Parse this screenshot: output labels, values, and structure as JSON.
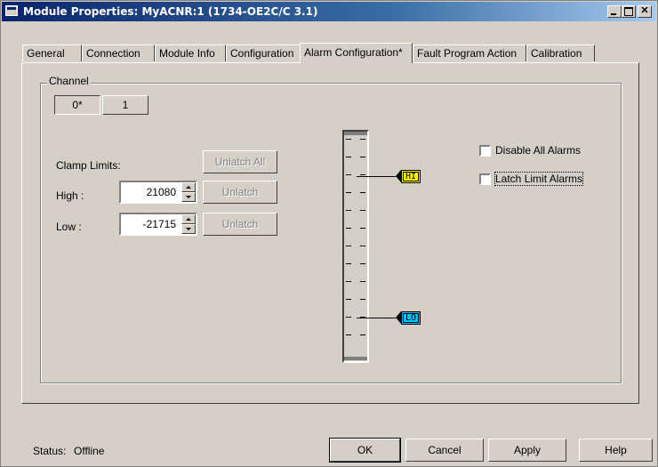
{
  "window": {
    "title": "Module Properties: MyACNR:1 (1734-OE2C/C 3.1)"
  },
  "tabs": [
    {
      "label": "General"
    },
    {
      "label": "Connection"
    },
    {
      "label": "Module Info"
    },
    {
      "label": "Configuration"
    },
    {
      "label": "Alarm Configuration*"
    },
    {
      "label": "Fault Program Action"
    },
    {
      "label": "Calibration"
    }
  ],
  "active_tab": "Alarm Configuration*",
  "channel": {
    "group_label": "Channel",
    "buttons": [
      {
        "label": "0*",
        "selected": true
      },
      {
        "label": "1",
        "selected": false
      }
    ]
  },
  "clamp": {
    "label": "Clamp Limits:",
    "unlatch_all_label": "Unlatch All",
    "high_label": "High :",
    "high_value": "21080",
    "low_label": "Low :",
    "low_value": "-21715",
    "unlatch_label": "Unlatch"
  },
  "gauge": {
    "hi_tag": "HI",
    "lo_tag": "LO",
    "hi_color": "#ffff00",
    "lo_color": "#00c0ff"
  },
  "options": {
    "disable_all_alarms": {
      "label": "Disable All Alarms",
      "checked": false
    },
    "latch_limit_alarms": {
      "label": "Latch Limit Alarms",
      "checked": false
    }
  },
  "status": {
    "label": "Status:",
    "value": "Offline"
  },
  "buttons": {
    "ok": "OK",
    "cancel": "Cancel",
    "apply": "Apply",
    "help": "Help"
  }
}
